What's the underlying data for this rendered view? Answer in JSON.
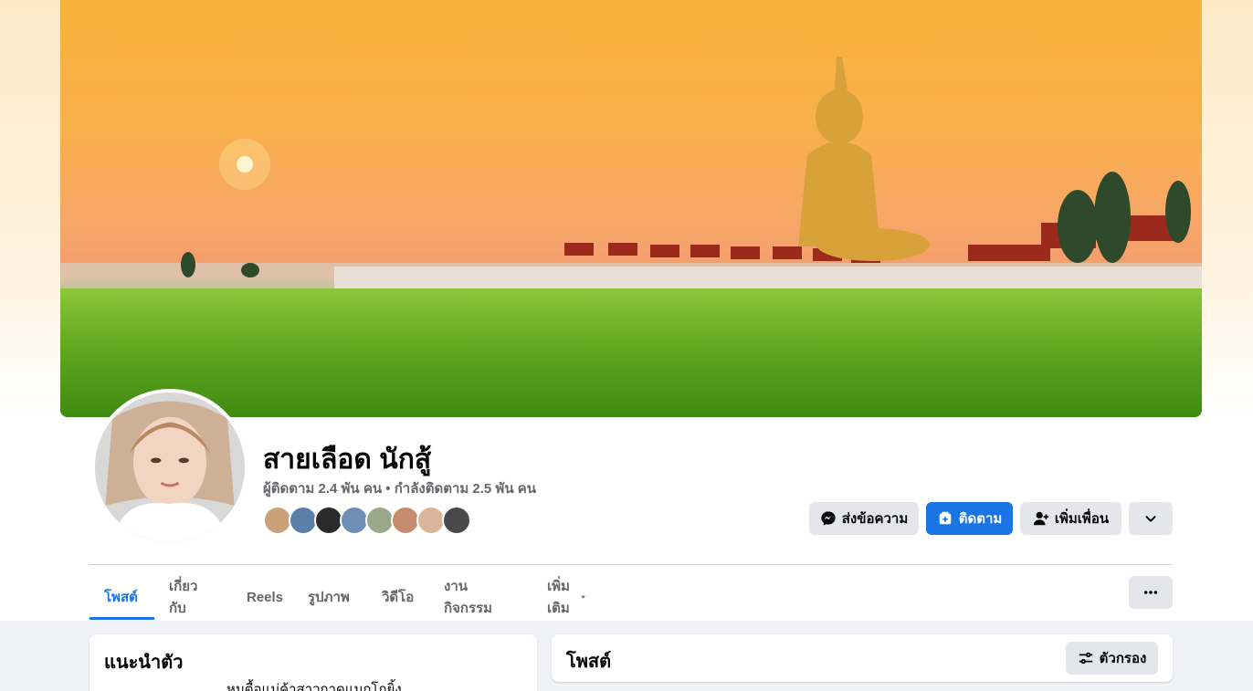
{
  "profile": {
    "name": "สายเลือด นักสู้",
    "follow_stats": "ผู้ติดตาม 2.4 พัน คน • กำลังติดตาม 2.5 พัน คน",
    "cover_icon": "cover-photo",
    "avatar_icon": "profile-photo"
  },
  "friends": {
    "count_shown": 8,
    "colors": [
      "#c9a27a",
      "#5a7fa8",
      "#2b2b2b",
      "#6d8fb5",
      "#9aa88a",
      "#c68b6e",
      "#d9b59a",
      "#4a4a4a"
    ]
  },
  "actions": {
    "message_label": "ส่งข้อความ",
    "message_icon": "messenger-icon",
    "follow_label": "ติดตาม",
    "follow_icon": "follow-icon",
    "add_friend_label": "เพิ่มเพื่อน",
    "add_friend_icon": "add-friend-icon",
    "dropdown_icon": "chevron-down-icon"
  },
  "tabs": [
    {
      "label": "โพสต์",
      "active": true
    },
    {
      "label": "เกี่ยวกับ",
      "active": false
    },
    {
      "label": "Reels",
      "active": false
    },
    {
      "label": "รูปภาพ",
      "active": false
    },
    {
      "label": "วิดีโอ",
      "active": false
    },
    {
      "label": "งานกิจกรรม",
      "active": false
    },
    {
      "label": "เพิ่มเติม",
      "active": false
    }
  ],
  "intro": {
    "title": "แนะนำตัว",
    "text": "หมูตื้อแม่ค้าสาวกาดแมกโกยิ้ง"
  },
  "posts": {
    "title": "โพสต์",
    "filter_label": "ตัวกรอง",
    "filter_icon": "filter-icon"
  },
  "colors": {
    "accent": "#1b74e4",
    "secondary_button": "#e4e6eb",
    "muted_text": "#65676b",
    "page_background": "#f0f2f5"
  }
}
